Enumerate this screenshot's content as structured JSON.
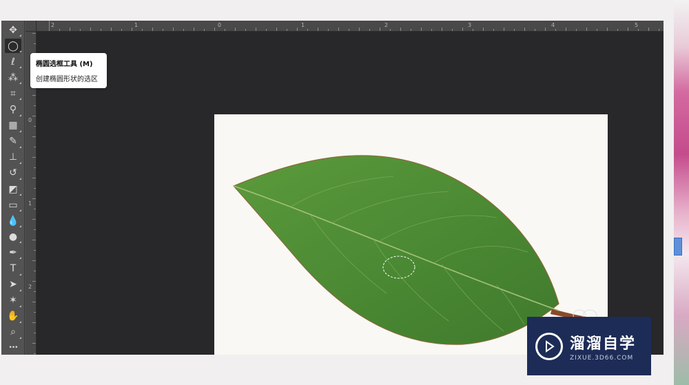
{
  "tooltip": {
    "title": "椭圆选框工具 (M)",
    "description": "创建椭圆形状的选区"
  },
  "rulers": {
    "top_labels": [
      "2",
      "1",
      "0",
      "1",
      "2",
      "3",
      "4",
      "5"
    ],
    "left_labels": [
      "0",
      "1",
      "2"
    ]
  },
  "tools": [
    {
      "name": "move-tool",
      "icon": "move-icon",
      "glyph": "✥"
    },
    {
      "name": "elliptical-marquee-tool",
      "icon": "ellipse-marquee-icon",
      "glyph": "◯",
      "active": true
    },
    {
      "name": "lasso-tool",
      "icon": "lasso-icon",
      "glyph": "ℓ"
    },
    {
      "name": "magic-wand-tool",
      "icon": "magic-wand-icon",
      "glyph": "⁂"
    },
    {
      "name": "crop-tool",
      "icon": "crop-icon",
      "glyph": "⌗"
    },
    {
      "name": "eyedropper-tool",
      "icon": "eyedropper-icon",
      "glyph": "⚲"
    },
    {
      "name": "healing-brush-tool",
      "icon": "bandage-icon",
      "glyph": "▦"
    },
    {
      "name": "brush-tool",
      "icon": "brush-icon",
      "glyph": "✎"
    },
    {
      "name": "clone-stamp-tool",
      "icon": "stamp-icon",
      "glyph": "⊥"
    },
    {
      "name": "history-brush-tool",
      "icon": "history-brush-icon",
      "glyph": "↺"
    },
    {
      "name": "eraser-tool",
      "icon": "eraser-icon",
      "glyph": "◩"
    },
    {
      "name": "gradient-tool",
      "icon": "gradient-icon",
      "glyph": "▭"
    },
    {
      "name": "blur-tool",
      "icon": "drop-icon",
      "glyph": "💧"
    },
    {
      "name": "dodge-tool",
      "icon": "dodge-icon",
      "glyph": "●"
    },
    {
      "name": "pen-tool",
      "icon": "pen-icon",
      "glyph": "✒"
    },
    {
      "name": "type-tool",
      "icon": "type-icon",
      "glyph": "T"
    },
    {
      "name": "path-selection-tool",
      "icon": "arrow-icon",
      "glyph": "➤"
    },
    {
      "name": "custom-shape-tool",
      "icon": "shape-icon",
      "glyph": "✶"
    },
    {
      "name": "hand-tool",
      "icon": "hand-icon",
      "glyph": "✋"
    },
    {
      "name": "zoom-tool",
      "icon": "zoom-icon",
      "glyph": "⌕"
    },
    {
      "name": "more-tools",
      "icon": "ellipsis-icon",
      "glyph": "•••"
    }
  ],
  "watermark": {
    "brand": "溜溜自学",
    "url": "ZIXUE.3D66.COM"
  },
  "colors": {
    "app_bg": "#535353",
    "canvas_bg": "#28272a",
    "leaf": "#4f8a35",
    "watermark_bg": "#1d2c57"
  }
}
